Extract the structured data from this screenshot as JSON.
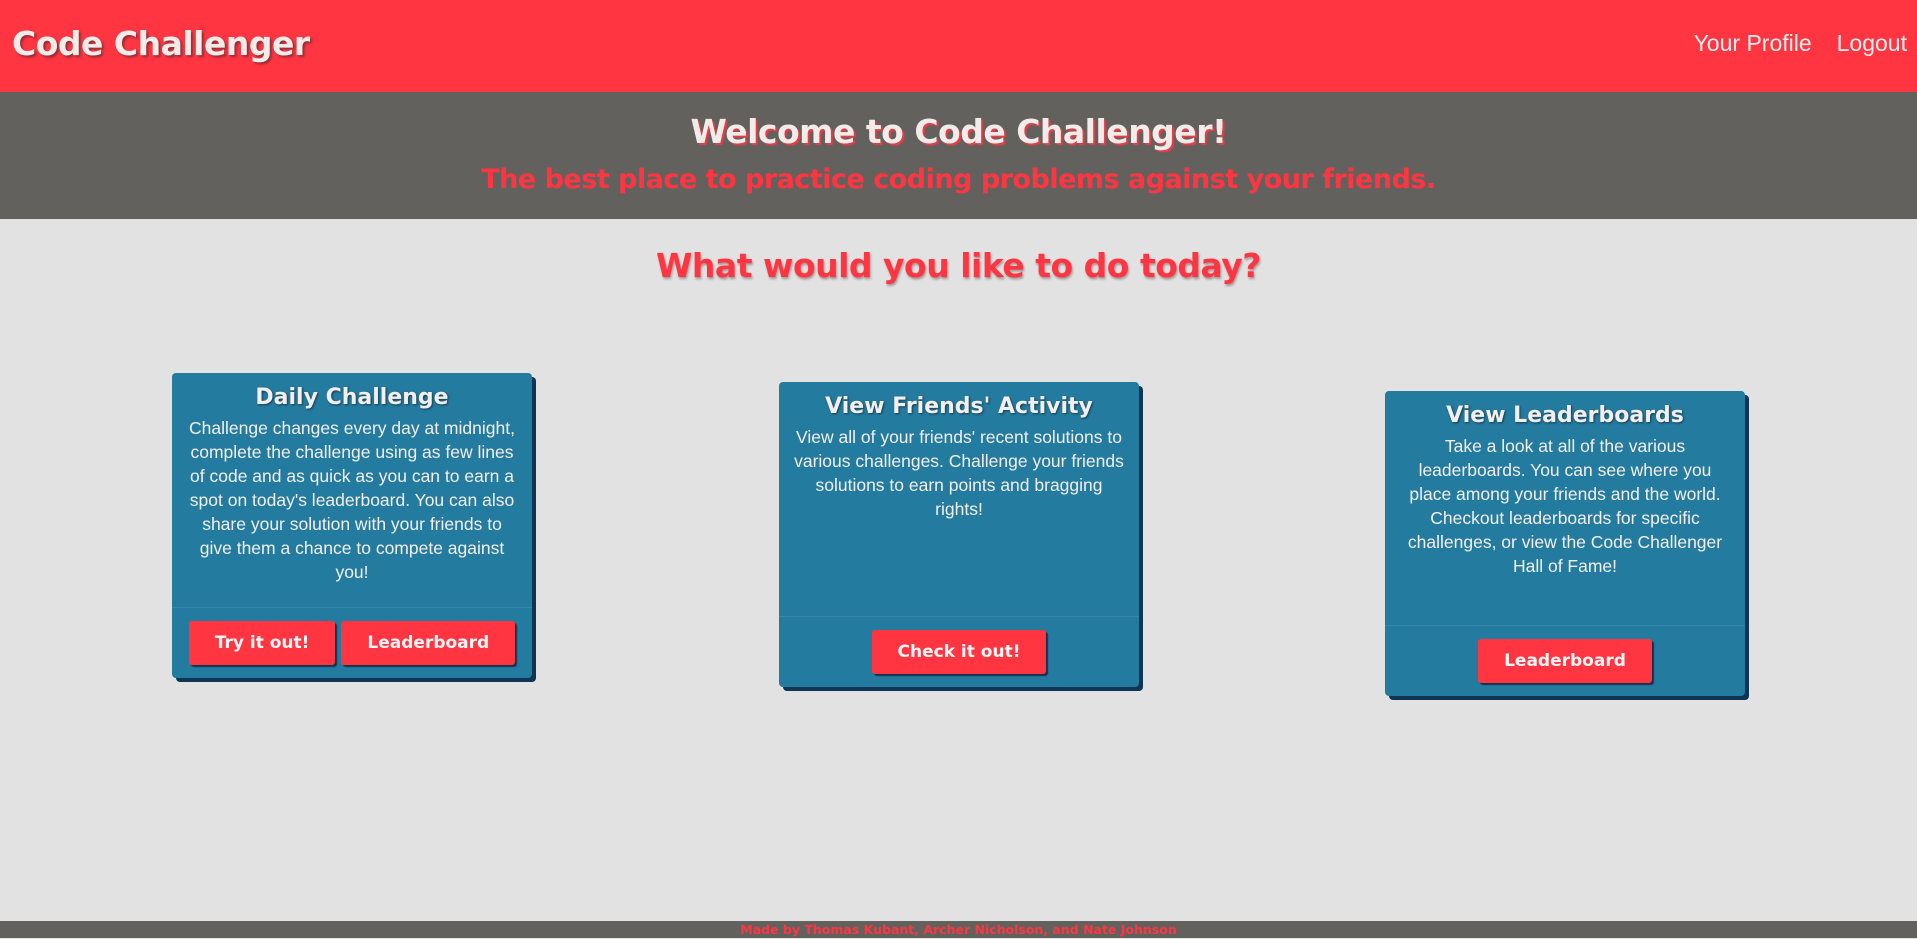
{
  "navbar": {
    "brand": "Code Challenger",
    "links": [
      "Your Profile",
      "Logout"
    ]
  },
  "hero": {
    "title": "Welcome to Code Challenger!",
    "subtitle": "The best place to practice coding problems against your friends."
  },
  "main": {
    "question": "What would you like to do today?",
    "cards": [
      {
        "title": "Daily Challenge",
        "text": "Challenge changes every day at midnight, complete the challenge using as few lines of code and as quick as you can to earn a spot on today's leaderboard. You can also share your solution with your friends to give them a chance to compete against you!",
        "buttons": [
          "Try it out!",
          "Leaderboard"
        ]
      },
      {
        "title": "View Friends' Activity",
        "text": "View all of your friends' recent solutions to various challenges. Challenge your friends solutions to earn points and bragging rights!",
        "buttons": [
          "Check it out!"
        ]
      },
      {
        "title": "View Leaderboards",
        "text": "Take a look at all of the various leaderboards. You can see where you place among your friends and the world. Checkout leaderboards for specific challenges, or view the Code Challenger Hall of Fame!",
        "buttons": [
          "Leaderboard"
        ]
      }
    ]
  },
  "footer": {
    "credits": "Made by Thomas Kubant, Archer Nicholson, and Nate Johnson"
  },
  "colors": {
    "navbar": "#ff3542",
    "hero": "#63615e",
    "background": "#e2e2e2",
    "card": "#247ba0",
    "button": "#ff3542"
  }
}
